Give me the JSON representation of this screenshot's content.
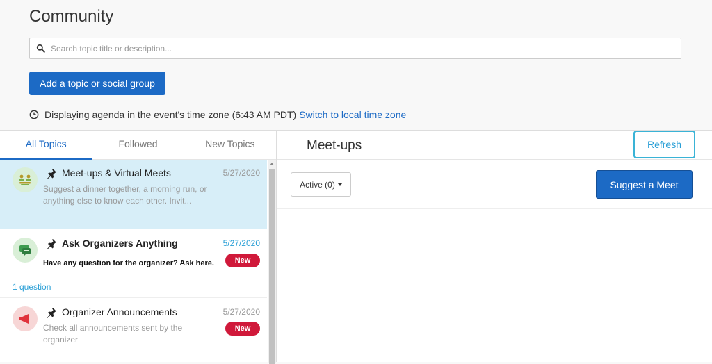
{
  "page": {
    "title": "Community"
  },
  "search": {
    "placeholder": "Search topic title or description..."
  },
  "actions": {
    "add_topic_label": "Add a topic or social group"
  },
  "timezone": {
    "text": "Displaying agenda in the event's time zone (6:43 AM PDT)",
    "link": "Switch to local time zone"
  },
  "tabs": [
    {
      "label": "All Topics",
      "active": true
    },
    {
      "label": "Followed",
      "active": false
    },
    {
      "label": "New Topics",
      "active": false
    }
  ],
  "topics": [
    {
      "title": "Meet-ups & Virtual Meets",
      "date": "5/27/2020",
      "description": "Suggest a dinner together, a morning run, or anything else to know each other. Invit...",
      "icon": "meetup-group-icon"
    },
    {
      "title": "Ask Organizers Anything",
      "date": "5/27/2020",
      "description": "Have any question for the organizer? Ask here.",
      "badge": "New",
      "question_count": "1 question",
      "icon": "chat-bubble-icon"
    },
    {
      "title": "Organizer Announcements",
      "date": "5/27/2020",
      "description": "Check all announcements sent by the organizer",
      "badge": "New",
      "icon": "megaphone-icon"
    }
  ],
  "detail": {
    "title": "Meet-ups",
    "refresh_label": "Refresh",
    "filter_label": "Active (0)",
    "suggest_label": "Suggest a Meet"
  },
  "colors": {
    "primary": "#1c6ac5",
    "accent": "#2a9fd6",
    "badge": "#d0193a",
    "selected_row": "#d7eef8"
  }
}
